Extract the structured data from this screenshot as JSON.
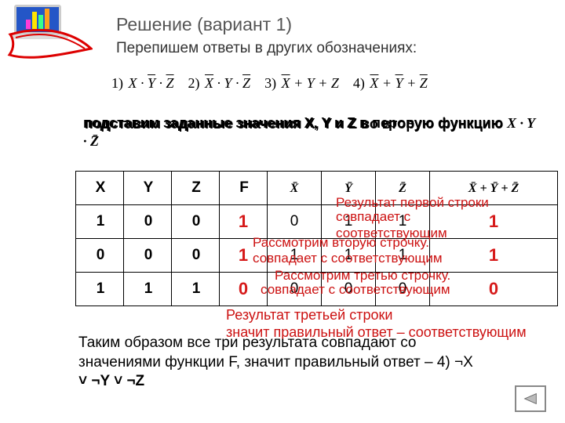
{
  "title": "Решение (вариант 1)",
  "subtitle": "Перепишем ответы в других обозначениях:",
  "formulas": {
    "p1": "1)",
    "p2": "2)",
    "p3": "3)",
    "p4": "4)",
    "e1_a": "X",
    "e1_b": "Y",
    "e1_c": "Z",
    "e2_a": "X",
    "e2_b": "Y",
    "e2_c": "Z",
    "e3_a": "X",
    "e3_b": "Y",
    "e3_c": "Z",
    "e4_a": "X",
    "e4_b": "Y",
    "e4_c": "Z"
  },
  "mid_text_a": "подставим заданные значения X, Y и Z в перовую функцию",
  "mid_text_b": "подставим заданные значения X, Y и Z во вторую функцию",
  "mid_text_tail": "X · Y · Z̄",
  "table": {
    "head": {
      "X": "X",
      "Y": "Y",
      "Z": "Z",
      "F": "F",
      "Xb": "X̄",
      "Yb": "Ȳ",
      "Zb": "Z̄",
      "exp": "X̄ + Ȳ + Z̄"
    },
    "rows": [
      {
        "X": "1",
        "Y": "0",
        "Z": "0",
        "F": "1",
        "c5": "0",
        "c6": "1",
        "c7": "1",
        "c8": "1"
      },
      {
        "X": "0",
        "Y": "0",
        "Z": "0",
        "F": "1",
        "c5": "1",
        "c6": "1",
        "c7": "1",
        "c8": "1"
      },
      {
        "X": "1",
        "Y": "1",
        "Z": "1",
        "F": "0",
        "c5": "0",
        "c6": "0",
        "c7": "0",
        "c8": "0"
      }
    ]
  },
  "notes": {
    "n1": "Результат первой строки совпадает с",
    "n1b": "соответствующим",
    "n2a": "Рассмотрим вторую строчку.",
    "n2b": "совпадает с соответствующим",
    "n3a": "Рассмотрим третью строчку.",
    "n3b": "совпадает с соответствующим",
    "n4": "Результат третьей строки",
    "n5": "значит правильный ответ – соответствующим"
  },
  "conclusion_a": "Таким образом все три результата совпадают со",
  "conclusion_b": "значениями функции F, значит правильный ответ – 4)   ¬X",
  "conclusion_c": "˅ ¬Y ˅ ¬Z",
  "nav_label": "back"
}
